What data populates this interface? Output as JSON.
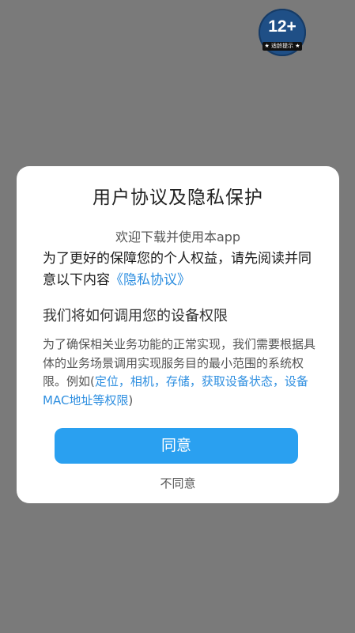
{
  "age_badge": {
    "rating": "12+",
    "strip_text": "★ 适龄提示 ★"
  },
  "dialog": {
    "title": "用户协议及隐私保护",
    "welcome": "欢迎下载并使用本app",
    "intro": {
      "text_before_link": "为了更好的保障您的个人权益，请先阅读并同意以下内容",
      "privacy_link": "《隐私协议》"
    },
    "permissions": {
      "heading": "我们将如何调用您的设备权限",
      "text": "为了确保相关业务功能的正常实现，我们需要根据具体的业务场景调用实现服务目的最小范围的系统权限。例如(",
      "links": "定位，相机，存储，获取设备状态，设备MAC地址等权限",
      "closing": ")"
    },
    "agree_label": "同意",
    "disagree_label": "不同意"
  },
  "colors": {
    "overlay": "#7a7a7a",
    "accent": "#2aa0f0",
    "link": "#2f8fe0",
    "badge": "#1f4f86"
  }
}
